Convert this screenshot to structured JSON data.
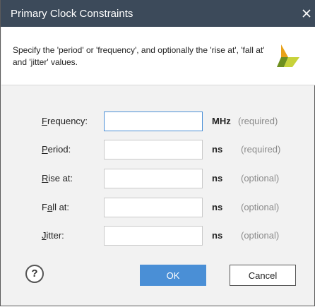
{
  "window": {
    "title": "Primary Clock Constraints",
    "close_icon": "close-icon"
  },
  "header": {
    "description": "Specify the 'period' or 'frequency', and optionally the 'rise at', 'fall at' and 'jitter' values.",
    "logo_icon": "xilinx-logo-icon"
  },
  "fields": [
    {
      "label_mnemonic": "F",
      "label_rest": "requency:",
      "value": "",
      "unit": "MHz",
      "hint": "(required)",
      "focused": true
    },
    {
      "label_mnemonic": "P",
      "label_rest": "eriod:",
      "value": "",
      "unit": "ns",
      "hint": "(required)",
      "focused": false
    },
    {
      "label_mnemonic": "R",
      "label_rest": "ise at:",
      "value": "",
      "unit": "ns",
      "hint": "(optional)",
      "focused": false
    },
    {
      "label_pre": "F",
      "label_mnemonic": "a",
      "label_rest": "ll at:",
      "value": "",
      "unit": "ns",
      "hint": "(optional)",
      "focused": false
    },
    {
      "label_mnemonic": "J",
      "label_rest": "itter:",
      "value": "",
      "unit": "ns",
      "hint": "(optional)",
      "focused": false
    }
  ],
  "footer": {
    "help_label": "?",
    "help_icon": "help-icon",
    "ok_label": "OK",
    "cancel_label": "Cancel"
  },
  "colors": {
    "titlebar": "#3c4a5a",
    "accent": "#4a8fd6",
    "dialog_bg": "#f2f2f2",
    "hint": "#8a8a8a"
  }
}
